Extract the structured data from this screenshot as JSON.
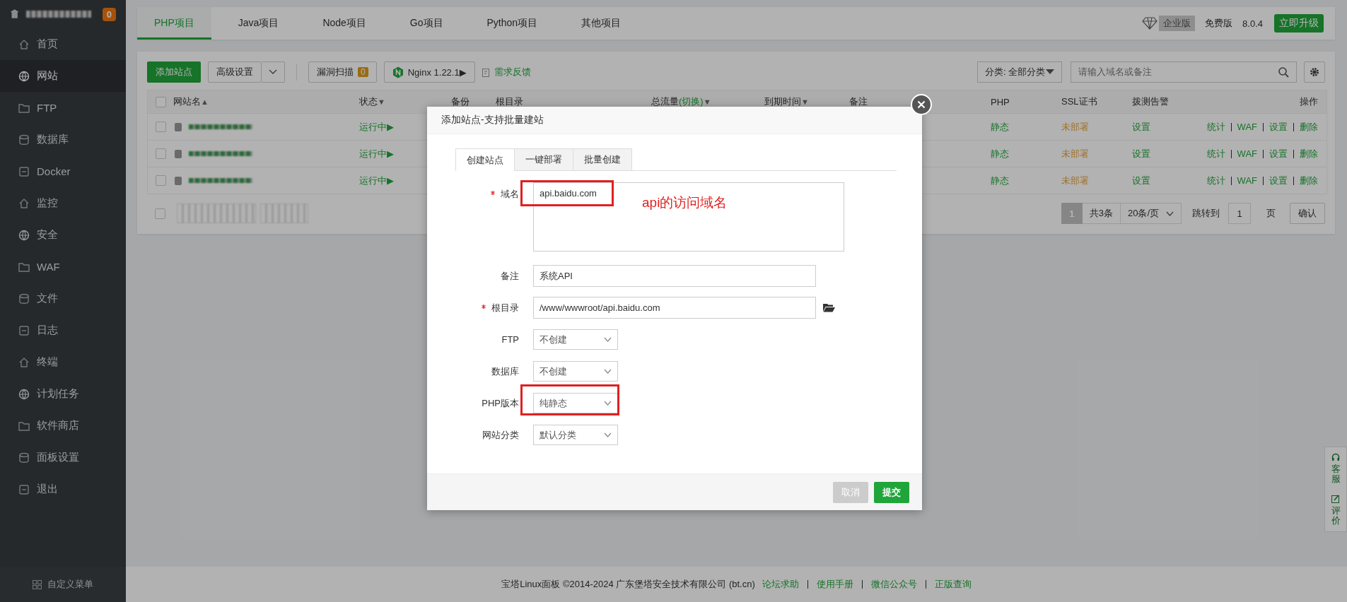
{
  "sidebar": {
    "badge": "0",
    "items": [
      {
        "label": "首页",
        "selected": false
      },
      {
        "label": "网站",
        "selected": true
      },
      {
        "label": "FTP",
        "selected": false
      },
      {
        "label": "数据库",
        "selected": false
      },
      {
        "label": "Docker",
        "selected": false
      },
      {
        "label": "监控",
        "selected": false
      },
      {
        "label": "安全",
        "selected": false
      },
      {
        "label": "WAF",
        "selected": false
      },
      {
        "label": "文件",
        "selected": false
      },
      {
        "label": "日志",
        "selected": false
      },
      {
        "label": "终端",
        "selected": false
      },
      {
        "label": "计划任务",
        "selected": false
      },
      {
        "label": "软件商店",
        "selected": false
      },
      {
        "label": "面板设置",
        "selected": false
      },
      {
        "label": "退出",
        "selected": false
      }
    ],
    "custom_menu": "自定义菜单"
  },
  "project_tabs": [
    {
      "label": "PHP项目",
      "selected": true
    },
    {
      "label": "Java项目",
      "selected": false
    },
    {
      "label": "Node项目",
      "selected": false
    },
    {
      "label": "Go项目",
      "selected": false
    },
    {
      "label": "Python项目",
      "selected": false
    },
    {
      "label": "其他项目",
      "selected": false
    }
  ],
  "edition": {
    "enterprise": "企业版",
    "free": "免费版",
    "version": "8.0.4",
    "upgrade": "立即升级"
  },
  "toolbar": {
    "add_site": "添加站点",
    "advanced": "高级设置",
    "scan": "漏洞扫描",
    "scan_count": "0",
    "nginx": "Nginx 1.22.1▶",
    "feedback": "需求反馈",
    "category": "分类: 全部分类",
    "search": {
      "placeholder": "请输入域名或备注"
    }
  },
  "table": {
    "select_all_checked": false,
    "bottom_select_all_checked": false,
    "columns": [
      {
        "label": "网站名",
        "suffix": "▲"
      },
      {
        "label": "状态",
        "suffix": "▼"
      },
      {
        "label": "备份"
      },
      {
        "label": "根目录"
      },
      {
        "label": "总流量",
        "link": "(切换)",
        "suffix": "▼"
      },
      {
        "label": "到期时间",
        "suffix": "▼"
      },
      {
        "label": "备注"
      },
      {
        "label": "PHP"
      },
      {
        "label": "SSL证书"
      },
      {
        "label": "拨测告警"
      },
      {
        "label": "操作"
      }
    ],
    "rows": [
      {
        "checked": false,
        "status": "运行中▶",
        "php": "静态",
        "ssl": "未部署",
        "alert": "设置",
        "actions": [
          "统计",
          "WAF",
          "设置",
          "删除"
        ]
      },
      {
        "checked": false,
        "status": "运行中▶",
        "php": "静态",
        "ssl": "未部署",
        "alert": "设置",
        "actions": [
          "统计",
          "WAF",
          "设置",
          "删除"
        ]
      },
      {
        "checked": false,
        "status": "运行中▶",
        "php": "静态",
        "ssl": "未部署",
        "alert": "设置",
        "actions": [
          "统计",
          "WAF",
          "设置",
          "删除"
        ]
      }
    ],
    "pagination": {
      "page": "1",
      "total": "共3条",
      "per_page": "20条/页",
      "goto": "跳转到",
      "goto_value": "1",
      "page_unit": "页",
      "confirm": "确认"
    }
  },
  "modal": {
    "title": "添加站点-支持批量建站",
    "tabs": [
      {
        "label": "创建站点",
        "selected": true
      },
      {
        "label": "一键部署",
        "selected": false
      },
      {
        "label": "批量创建",
        "selected": false
      }
    ],
    "fields": [
      {
        "kind": "textarea",
        "label": "域名",
        "required": true,
        "value": "api.baidu.com",
        "highlighted": true
      },
      {
        "kind": "text",
        "label": "备注",
        "required": false,
        "value": "系统API",
        "highlighted": false
      },
      {
        "kind": "path",
        "label": "根目录",
        "required": true,
        "value": "/www/wwwroot/api.baidu.com",
        "highlighted": false
      },
      {
        "kind": "select",
        "label": "FTP",
        "required": false,
        "value": "不创建",
        "highlighted": false
      },
      {
        "kind": "select",
        "label": "数据库",
        "required": false,
        "value": "不创建",
        "highlighted": false
      },
      {
        "kind": "select",
        "label": "PHP版本",
        "required": false,
        "value": "纯静态",
        "highlighted": true
      },
      {
        "kind": "select",
        "label": "网站分类",
        "required": false,
        "value": "默认分类",
        "highlighted": false
      }
    ],
    "annotation": "api的访问域名",
    "cancel": "取消",
    "submit": "提交"
  },
  "footer": {
    "copyright": "宝塔Linux面板 ©2014-2024 广东堡塔安全技术有限公司 (bt.cn)",
    "links": [
      "论坛求助",
      "使用手册",
      "微信公众号",
      "正版查询"
    ]
  },
  "float_panel": [
    {
      "label": "客服"
    },
    {
      "label": "评价"
    }
  ]
}
